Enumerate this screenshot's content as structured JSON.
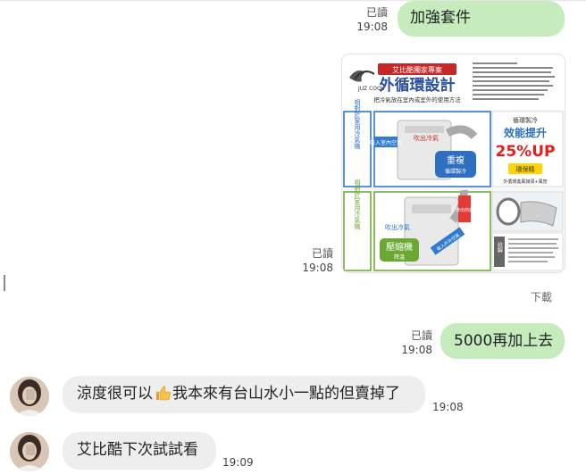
{
  "messages": [
    {
      "id": "m1",
      "direction": "out",
      "text": "加強套件",
      "read": "已讀",
      "time": "19:08"
    },
    {
      "id": "m2",
      "direction": "out",
      "kind": "image",
      "read": "已讀",
      "time": "19:08",
      "image_text": {
        "banner": "艾比酷獨家專案",
        "title": "外循環設計",
        "subtitle": "把冷氣放在室內或室外的使用方法",
        "logo": "JUZ COOL",
        "side_top": "相對於家用冷氣機",
        "side_top_label": "『室內機』",
        "side_bottom": "相對於家用冷氣機",
        "side_bottom_label": "『室外機』",
        "label_enter_air": "吸入室內空氣",
        "label_blow_cool": "吹出冷氣",
        "label_repeat": "重複",
        "label_repeat_sub": "循環製冷",
        "label_efficiency": "效能提升",
        "label_percent": "25%UP",
        "label_cycle_title": "循環製冷",
        "label_kit": "環保精",
        "label_kit_sub": "外循環進風接頭+風管",
        "label_compressor": "壓縮機",
        "label_compressor_sub": "降溫",
        "label_exhaust": "排出熱氣",
        "label_blow_cool_2": "吹出冷氣",
        "label_intake_2": "吸入戶外空氣",
        "label_note": "註解"
      },
      "download": "下載"
    },
    {
      "id": "m3",
      "direction": "out",
      "text": "5000再加上去",
      "read": "已讀",
      "time": "19:08"
    },
    {
      "id": "m4",
      "direction": "in",
      "text_before": "涼度很可以",
      "emoji": "thumbs-up",
      "text_after": "我本來有台山水小一點的但賣掉了",
      "time": "19:08"
    },
    {
      "id": "m5",
      "direction": "in",
      "text": "艾比酷下次試試看",
      "time": "19:09"
    }
  ],
  "colors": {
    "outgoing_bubble": "#c6ecbd",
    "incoming_bubble": "#eeeeef",
    "background": "#ffffff"
  }
}
